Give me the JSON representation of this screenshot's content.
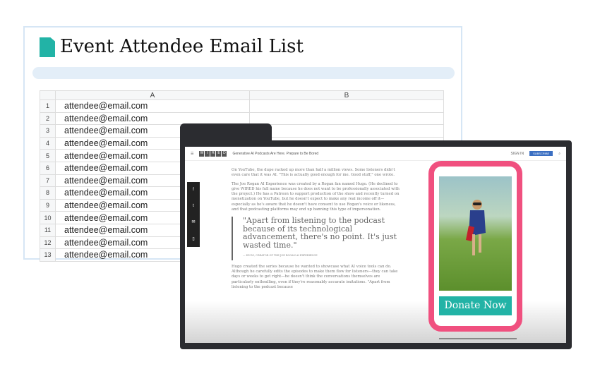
{
  "sheet": {
    "title": "Event Attendee Email List",
    "columns": [
      "A",
      "B"
    ],
    "rows": [
      {
        "n": "1",
        "a": "attendee@email.com"
      },
      {
        "n": "2",
        "a": "attendee@email.com"
      },
      {
        "n": "3",
        "a": "attendee@email.com"
      },
      {
        "n": "4",
        "a": "attendee@email.com"
      },
      {
        "n": "5",
        "a": "attendee@email.com"
      },
      {
        "n": "6",
        "a": "attendee@email.com"
      },
      {
        "n": "7",
        "a": "attendee@email.com"
      },
      {
        "n": "8",
        "a": "attendee@email.com"
      },
      {
        "n": "9",
        "a": "attendee@email.com"
      },
      {
        "n": "10",
        "a": "attendee@email.com"
      },
      {
        "n": "11",
        "a": "attendee@email.com"
      },
      {
        "n": "12",
        "a": "attendee@email.com"
      },
      {
        "n": "13",
        "a": "attendee@email.com"
      }
    ]
  },
  "browser": {
    "logo": [
      "W",
      "I",
      "R",
      "E",
      "D"
    ],
    "headline": "Generative AI Podcasts Are Here. Prepare to Be Bored",
    "signin": "SIGN IN",
    "subscribe": "SUBSCRIBE",
    "article": {
      "p1": "On YouTube, the dupe racked up more than half a million views. Some listeners didn't even care that it was AI. \"This is actually good enough for me. Good stuff,\" one wrote.",
      "p2": "The Joe Rogan AI Experience was created by a Rogan fan named Hugo. (He declined to give WIRED his full name because he does not want to be professionally associated with the project.) He has a Patreon to support production of the show and recently turned on monetization on YouTube, but he doesn't expect to make any real income off it—especially as he's aware that he doesn't have consent to use Rogan's voice or likeness, and that podcasting platforms may end up banning this type of impersonation.",
      "quote": "\"Apart from listening to the podcast because of its technological advancement, there's no point. It's just wasted time.\"",
      "caption": "— HUGO, CREATOR OF THE JOE ROGAN AI EXPERIENCE",
      "p3": "Hugo created the series because he wanted to showcase what AI voice tools can do. Although he carefully edits the episodes to make them flow for listeners—they can take days or weeks to get right—he doesn't think the conversations themselves are particularly enthralling, even if they're reasonably accurate imitations. \"Apart from listening to the podcast because"
    },
    "ad": {
      "button": "Donate Now"
    }
  },
  "colors": {
    "accent": "#22b3a6",
    "ad_border": "#f0507f"
  }
}
